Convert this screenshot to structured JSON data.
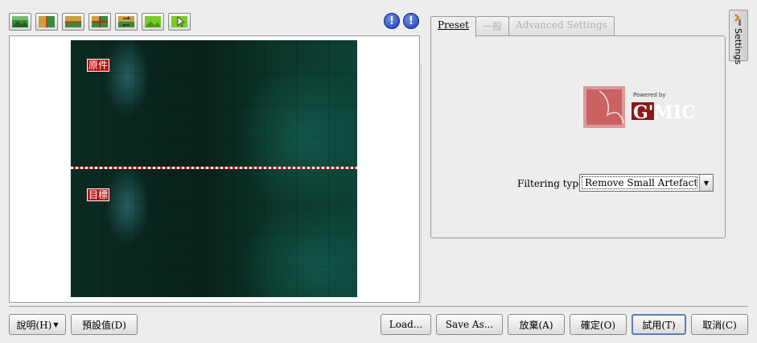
{
  "toolbar": {
    "icons": [
      "preview-original-icon",
      "split-vertical-icon",
      "split-horizontal-icon",
      "split-both-icon",
      "swap-icon",
      "preview-result-icon",
      "pointer-icon"
    ],
    "warn_labels": [
      "!",
      "!"
    ]
  },
  "preview": {
    "top_label": "原件",
    "bottom_label": "目標"
  },
  "tabs": [
    "Preset",
    "一般",
    "Advanced Settings"
  ],
  "logo": {
    "powered_by": "Powered by",
    "brand": "G'MIC"
  },
  "filter": {
    "label": "Filtering type:",
    "selected": "Remove Small Artefact"
  },
  "side_tab": {
    "label": "Settings"
  },
  "buttons": {
    "help": "說明(H)",
    "defaults": "預設值(D)",
    "load": "Load...",
    "save_as": "Save As...",
    "discard": "放棄(A)",
    "ok": "確定(O)",
    "try": "試用(T)",
    "cancel": "取消(C)"
  },
  "colors": {
    "accent": "#5c7fb8",
    "tag_red": "#b81212"
  }
}
